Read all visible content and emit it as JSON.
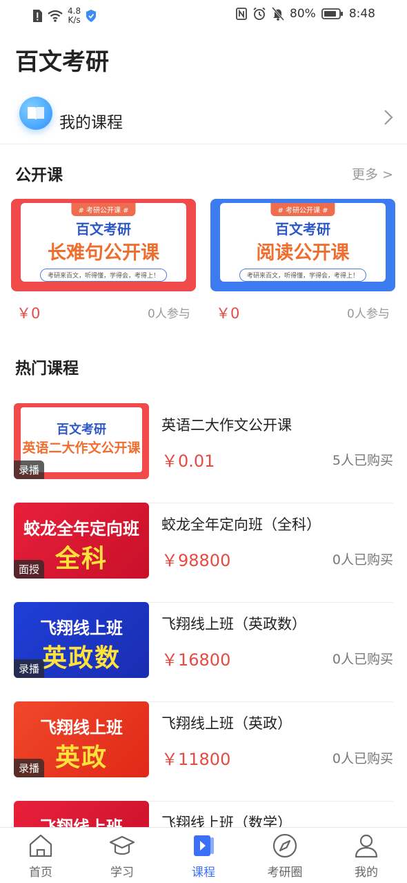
{
  "status_bar": {
    "net_speed_value": "4.8",
    "net_speed_unit": "K/s",
    "battery": "80%",
    "time": "8:48"
  },
  "app_title": "百文考研",
  "my_course": {
    "label": "我的课程"
  },
  "open_courses": {
    "title": "公开课",
    "more": "更多 >",
    "items": [
      {
        "tag": "# 考研公开课 #",
        "line1": "百文考研",
        "line2": "长难句公开课",
        "slogan": "考研来百文，听得懂，学得会，考得上！",
        "price": "￥0",
        "participants": "0人参与",
        "frame_color": "#f04a4a"
      },
      {
        "tag": "# 考研公开课 #",
        "line1": "百文考研",
        "line2": "阅读公开课",
        "slogan": "考研来百文，听得懂，学得会，考得上！",
        "price": "￥0",
        "participants": "0人参与",
        "frame_color": "#3d7cf0"
      }
    ]
  },
  "hot_courses": {
    "title": "热门课程",
    "items": [
      {
        "thumb_line1": "百文考研",
        "thumb_line2": "英语二大作文公开课",
        "badge": "录播",
        "title": "英语二大作文公开课",
        "price": "￥0.01",
        "buyers": "5人已购买"
      },
      {
        "thumb_line1": "蛟龙全年定向班",
        "thumb_line2": "全科",
        "badge": "面授",
        "title": "蛟龙全年定向班（全科）",
        "price": "￥98800",
        "buyers": "0人已购买"
      },
      {
        "thumb_line1": "飞翔线上班",
        "thumb_line2": "英政数",
        "badge": "录播",
        "title": "飞翔线上班（英政数）",
        "price": "￥16800",
        "buyers": "0人已购买"
      },
      {
        "thumb_line1": "飞翔线上班",
        "thumb_line2": "英政",
        "badge": "录播",
        "title": "飞翔线上班（英政）",
        "price": "￥11800",
        "buyers": "0人已购买"
      },
      {
        "thumb_line1": "飞翔线上班",
        "thumb_line2": "",
        "badge": "",
        "title": "飞翔线上班（数学）",
        "price": "",
        "buyers": ""
      }
    ]
  },
  "tab_bar": {
    "items": [
      {
        "label": "首页",
        "icon": "home-icon"
      },
      {
        "label": "学习",
        "icon": "graduation-cap-icon"
      },
      {
        "label": "课程",
        "icon": "play-book-icon",
        "active": true
      },
      {
        "label": "考研圈",
        "icon": "compass-icon"
      },
      {
        "label": "我的",
        "icon": "user-icon"
      }
    ],
    "active_color": "#3b6ff5"
  }
}
